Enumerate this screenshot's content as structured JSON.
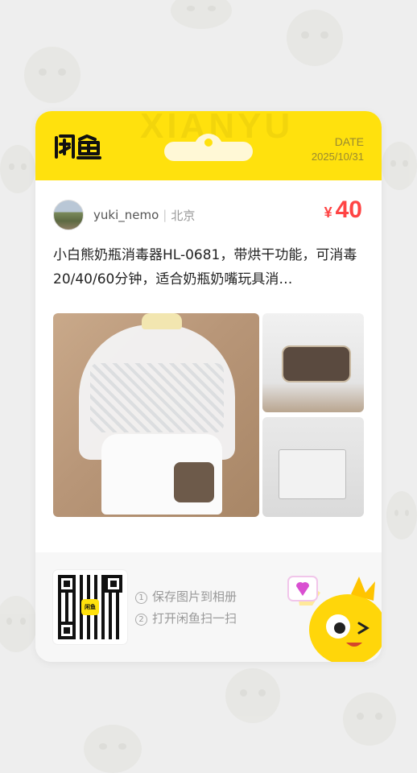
{
  "header": {
    "logo_text": "闲鱼",
    "watermark_text": "XIANYU",
    "date_label": "DATE",
    "date_value": "2025/10/31"
  },
  "seller": {
    "name": "yuki_nemo",
    "separator": "|",
    "city": "北京"
  },
  "price": {
    "symbol": "¥",
    "value": "40",
    "color": "#ff4444"
  },
  "item": {
    "description": "小白熊奶瓶消毒器HL-0681，带烘干功能，可消毒20/40/60分钟，适合奶瓶奶嘴玩具消…"
  },
  "photos": {
    "count": 3
  },
  "footer": {
    "qr_badge": "闲鱼",
    "steps": [
      {
        "num": "1",
        "text": "保存图片到相册"
      },
      {
        "num": "2",
        "text": "打开闲鱼扫一扫"
      }
    ]
  },
  "colors": {
    "brand_yellow": "#ffe10d",
    "background": "#eeeeee"
  }
}
